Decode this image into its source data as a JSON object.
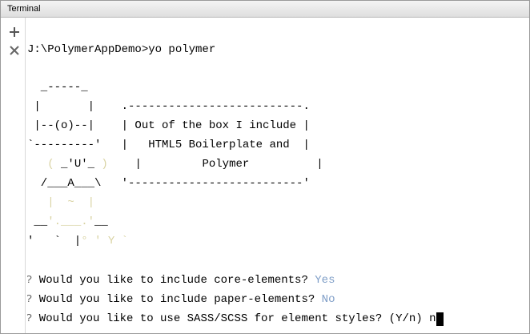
{
  "window": {
    "title": "Terminal"
  },
  "toolbar": {
    "new_icon": "plus-icon",
    "close_icon": "close-icon"
  },
  "terminal": {
    "command_line": "J:\\PolymerAppDemo>yo polymer",
    "art": {
      "l1": "  _-----_",
      "l2": " |       |    .--------------------------.",
      "l3": " |--(o)--|    | Out of the box I include |",
      "l4": "`---------'   |   HTML5 Boilerplate and  |",
      "l5a": "   ( ",
      "l5b": "_'U'_",
      "l5c": " )",
      "l5d": "    |         Polymer          |",
      "l6": "  /___A___\\   '--------------------------'",
      "l7a": "   |  ~  |",
      "l8a": " __",
      "l8b": "'.___.'",
      "l8c": "__",
      "l9a": "'   `  |",
      "l9b": "° ' Y `"
    },
    "prompts": [
      {
        "mark": "?",
        "question": " Would you like to include core-elements? ",
        "answer": "Yes"
      },
      {
        "mark": "?",
        "question": " Would you like to include paper-elements? ",
        "answer": "No"
      },
      {
        "mark": "?",
        "question": " Would you like to use SASS/SCSS for element styles? (Y/n) ",
        "answer": "n"
      }
    ]
  },
  "colors": {
    "answer": "#7f9ec7",
    "faint_art": "#d9d3a3",
    "text": "#000000"
  }
}
